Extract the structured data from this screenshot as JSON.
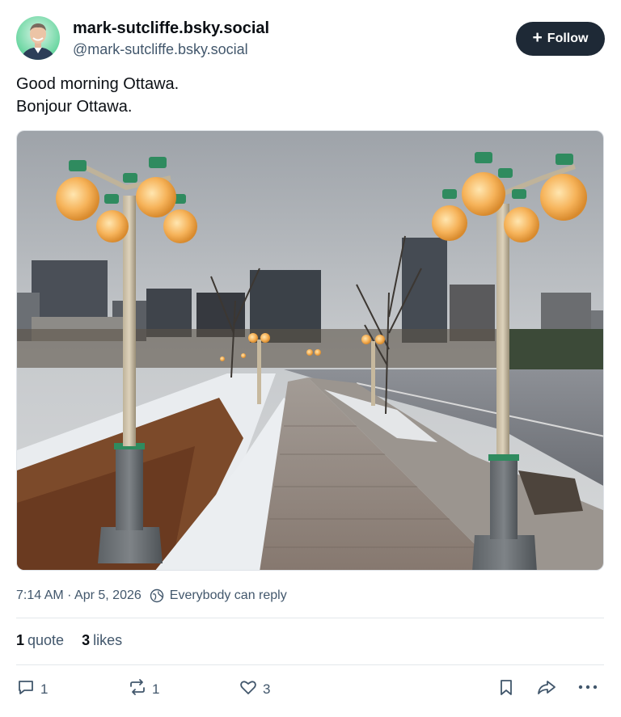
{
  "author": {
    "display_name": "mark-sutcliffe.bsky.social",
    "handle": "@mark-sutcliffe.bsky.social",
    "avatar_icon": "user-avatar-photo"
  },
  "follow_button": {
    "icon": "plus-icon",
    "label": "Follow"
  },
  "post": {
    "lines": [
      "Good morning Ottawa.",
      "Bonjour Ottawa."
    ],
    "image_icon": "photo-street-lamps-ottawa"
  },
  "meta": {
    "timestamp": "7:14 AM · Apr 5, 2026",
    "reply_setting_icon": "globe-icon",
    "reply_setting": "Everybody can reply"
  },
  "stats": {
    "quotes_count": "1",
    "quotes_label": "quote",
    "likes_count": "3",
    "likes_label": "likes"
  },
  "actions": {
    "reply_count": "1",
    "repost_count": "1",
    "like_count": "3"
  },
  "colors": {
    "follow_bg": "#1e2936",
    "secondary_text": "#42576c",
    "divider": "#e3e7eb"
  }
}
